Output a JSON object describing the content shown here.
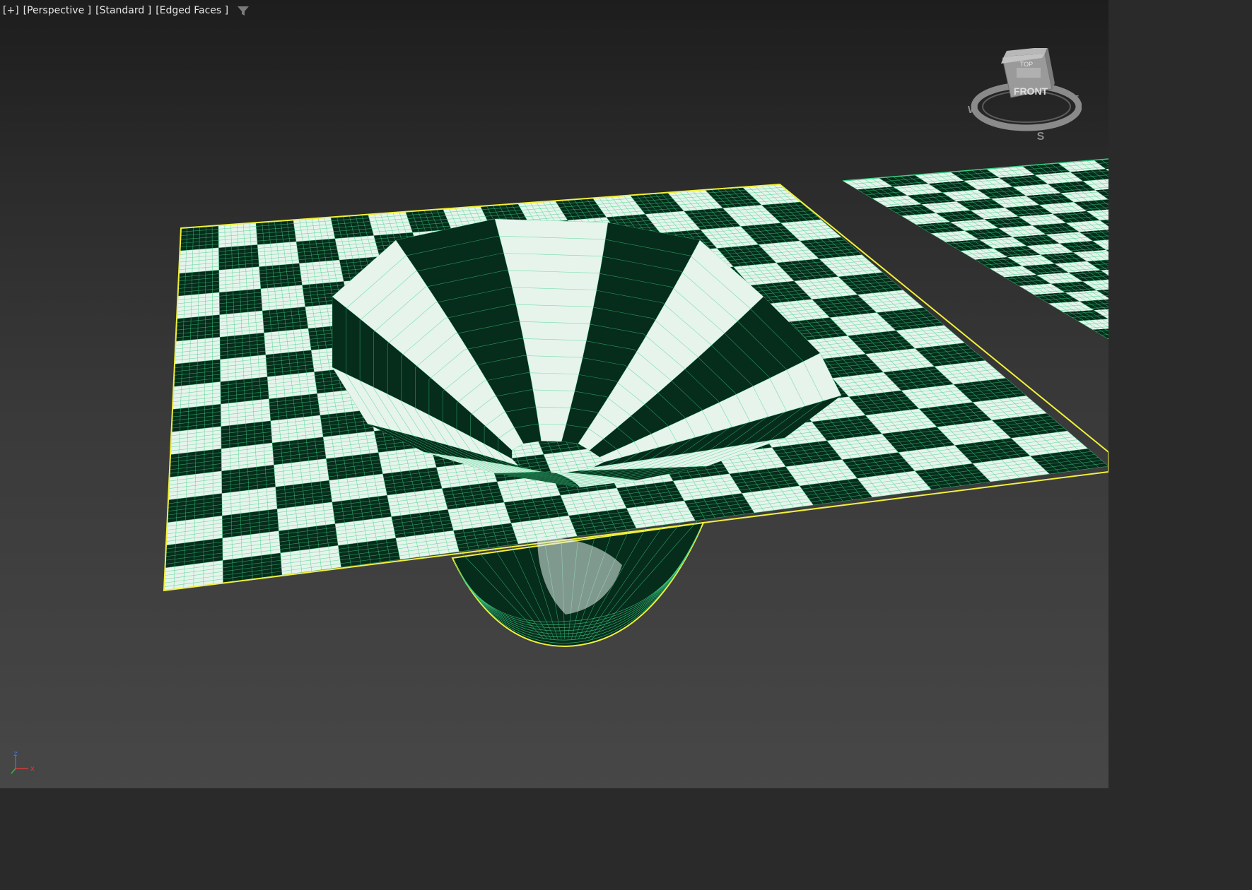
{
  "viewport": {
    "menu_label": "[+]",
    "view_label": "[Perspective ]",
    "shading_label": "[Standard ]",
    "display_label": "[Edged Faces ]",
    "filter_icon": "funnel-filter-icon"
  },
  "viewcube": {
    "face_front": "FRONT",
    "face_top": "TOP",
    "compass_west": "W",
    "compass_south": "S",
    "compass_east": "E"
  },
  "axis_tripod": {
    "z": "z",
    "x": "x"
  },
  "colors": {
    "checker_light": "#e6f4ec",
    "checker_dark": "#062c1b",
    "wire": "#3ecf86",
    "selection_outline": "#f0f03c",
    "label_text": "#e6e6e6"
  }
}
